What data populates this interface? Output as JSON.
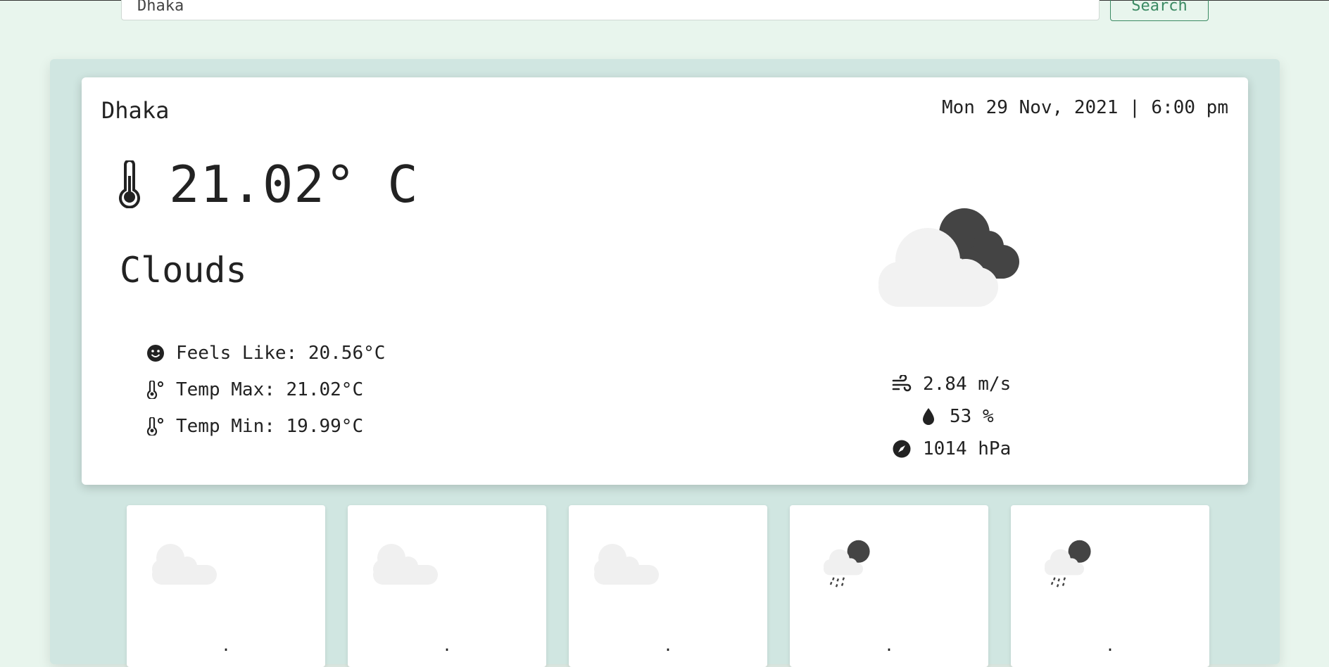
{
  "search": {
    "value": "Dhaka",
    "button_label": "Search"
  },
  "current": {
    "city": "Dhaka",
    "datetime": "Mon 29 Nov, 2021 | 6:00 pm",
    "temperature": "21.02° C",
    "condition": "Clouds",
    "condition_icon": "cloud-moon-icon",
    "details": [
      {
        "icon": "smile-icon",
        "text": "Feels Like: 20.56°C"
      },
      {
        "icon": "thermometer-degree-icon",
        "text": "Temp Max: 21.02°C"
      },
      {
        "icon": "thermometer-degree-icon",
        "text": "Temp Min: 19.99°C"
      }
    ],
    "stats": [
      {
        "icon": "wind-icon",
        "text": "2.84 m/s"
      },
      {
        "icon": "droplet-icon",
        "text": "53 %"
      },
      {
        "icon": "compass-icon",
        "text": "1014 hPa"
      }
    ]
  },
  "forecast": [
    {
      "icon": "cloud-icon",
      "text": "."
    },
    {
      "icon": "cloud-icon",
      "text": "."
    },
    {
      "icon": "cloud-icon",
      "text": "."
    },
    {
      "icon": "rain-moon-icon",
      "text": "."
    },
    {
      "icon": "rain-moon-icon",
      "text": "."
    }
  ],
  "colors": {
    "background": "#e8f5ed",
    "panel": "#d0e6e1",
    "accent": "#3b8a63"
  }
}
